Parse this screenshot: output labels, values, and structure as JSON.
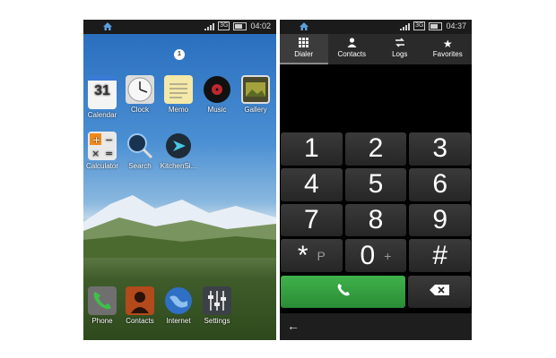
{
  "left_phone": {
    "status": {
      "time": "04:02",
      "network": "3G"
    },
    "page_indicator": "1",
    "apps_row1": [
      {
        "label": "Calendar",
        "icon": "calendar-icon",
        "detail": "31"
      },
      {
        "label": "Clock",
        "icon": "clock-icon"
      },
      {
        "label": "Memo",
        "icon": "memo-icon"
      },
      {
        "label": "Music",
        "icon": "music-icon"
      },
      {
        "label": "Gallery",
        "icon": "gallery-icon"
      }
    ],
    "apps_row2": [
      {
        "label": "Calculator",
        "icon": "calculator-icon"
      },
      {
        "label": "Search",
        "icon": "search-icon"
      },
      {
        "label": "KitchenSi...",
        "icon": "kitchensink-icon"
      }
    ],
    "dock": [
      {
        "label": "Phone",
        "icon": "phone-icon"
      },
      {
        "label": "Contacts",
        "icon": "contacts-icon"
      },
      {
        "label": "Internet",
        "icon": "globe-icon"
      },
      {
        "label": "Settings",
        "icon": "settings-icon"
      }
    ]
  },
  "right_phone": {
    "status": {
      "time": "04:37",
      "network": "3G"
    },
    "tabs": [
      {
        "label": "Dialer",
        "icon": "dialpad-icon",
        "active": true
      },
      {
        "label": "Contacts",
        "icon": "person-icon"
      },
      {
        "label": "Logs",
        "icon": "logs-icon"
      },
      {
        "label": "Favorites",
        "icon": "star-icon"
      }
    ],
    "keys": [
      {
        "main": "1",
        "sub": ""
      },
      {
        "main": "2",
        "sub": ""
      },
      {
        "main": "3",
        "sub": ""
      },
      {
        "main": "4",
        "sub": ""
      },
      {
        "main": "5",
        "sub": ""
      },
      {
        "main": "6",
        "sub": ""
      },
      {
        "main": "7",
        "sub": ""
      },
      {
        "main": "8",
        "sub": ""
      },
      {
        "main": "9",
        "sub": ""
      },
      {
        "main": "*",
        "sub": "P"
      },
      {
        "main": "0",
        "sub": "+"
      },
      {
        "main": "#",
        "sub": ""
      }
    ],
    "accent_call": "#3fb24b"
  }
}
